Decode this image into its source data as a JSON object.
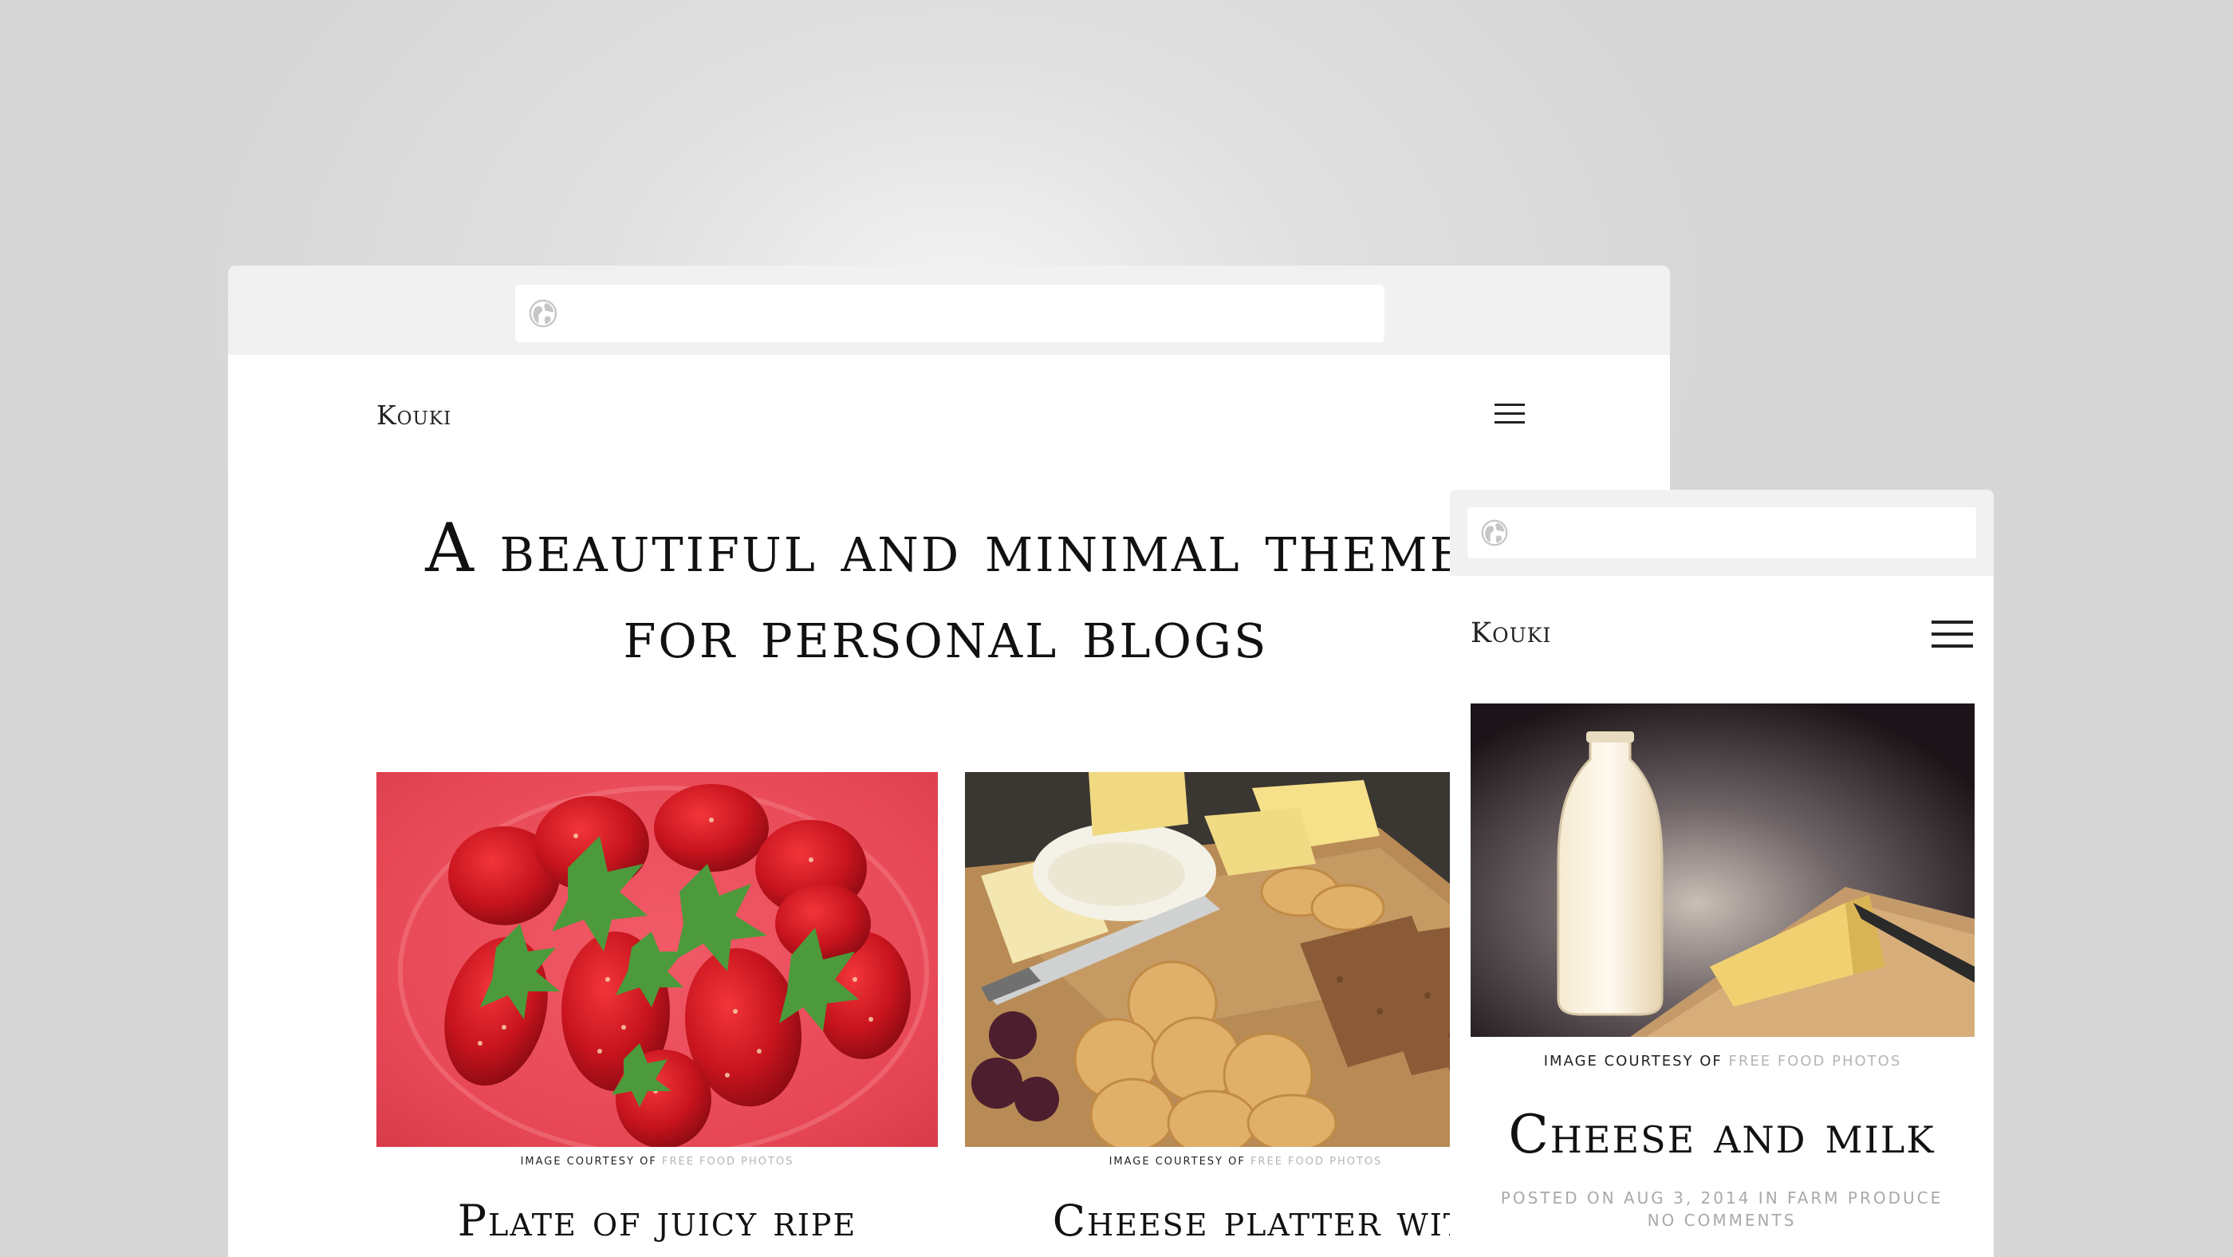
{
  "desktop": {
    "site_title": "Kouki",
    "tagline_line1": "A beautiful and minimal theme",
    "tagline_line2": "for personal blogs",
    "posts": [
      {
        "credit_prefix": "Image courtesy of",
        "credit_link": "Free Food Photos",
        "title": "Plate of juicy ripe"
      },
      {
        "credit_prefix": "Image courtesy of",
        "credit_link": "Free Food Photos",
        "title": "Cheese platter with"
      }
    ]
  },
  "mobile": {
    "site_title": "Kouki",
    "post": {
      "credit_prefix": "Image courtesy of",
      "credit_link": "Free Food Photos",
      "title": "Cheese and milk",
      "meta_line1": "Posted on Aug 3, 2014 in Farm Produce",
      "meta_line2": "No comments"
    }
  },
  "icons": [
    "globe-icon",
    "hamburger-menu-icon"
  ],
  "colors": {
    "background": "#d9d9d9",
    "browser_chrome": "#f1f1f1",
    "text": "#111111",
    "credit_link": "#b5b5b5",
    "meta_text": "#a9a9a9"
  }
}
